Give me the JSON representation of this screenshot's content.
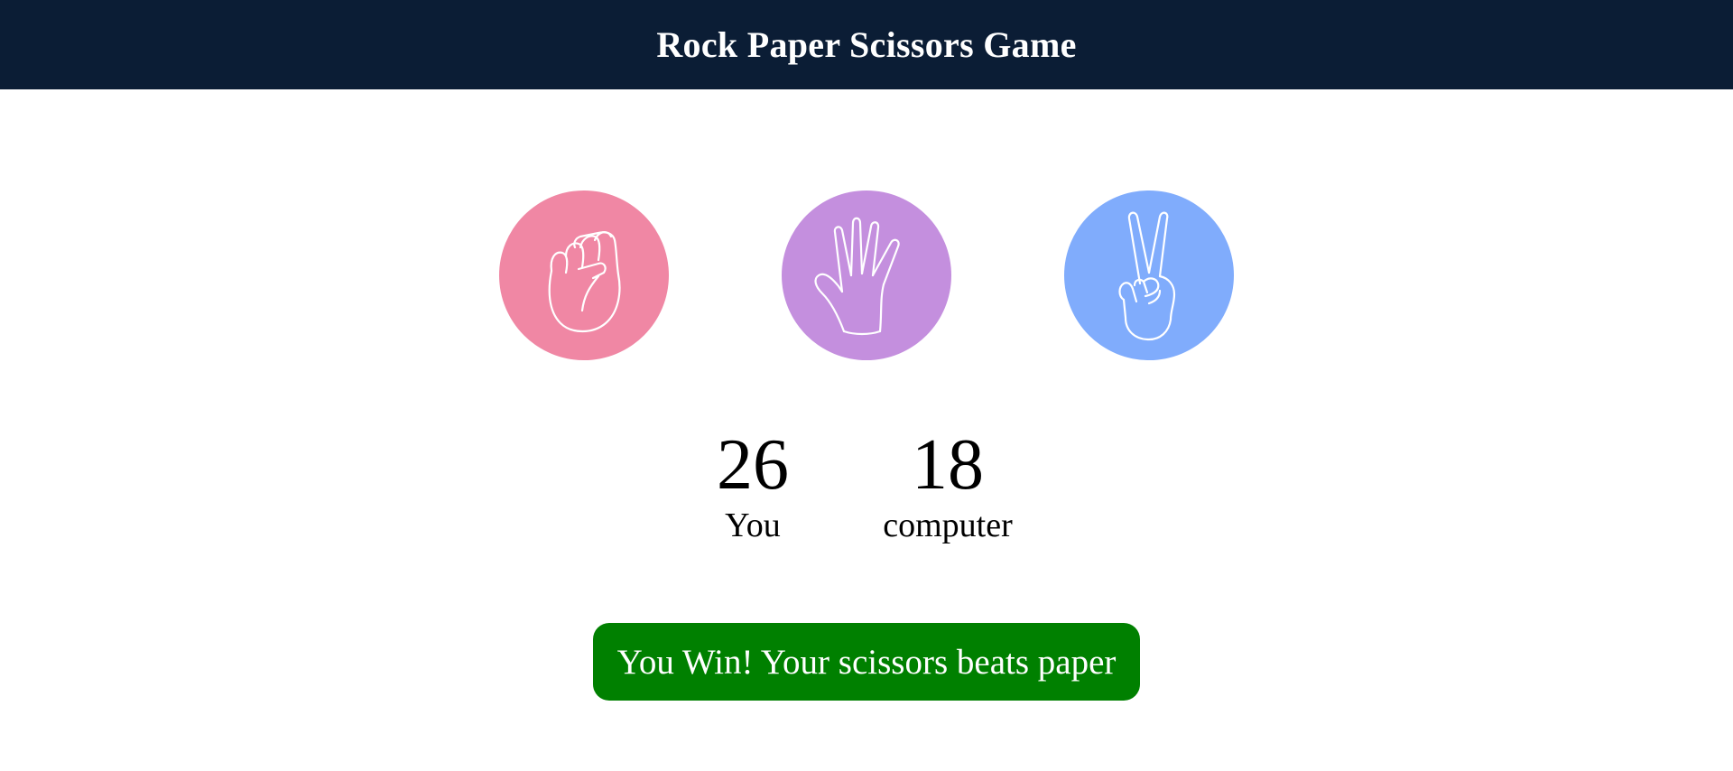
{
  "header": {
    "title": "Rock Paper Scissors Game"
  },
  "choices": [
    {
      "id": "rock",
      "icon": "rock-fist-icon",
      "color": "#f087a4"
    },
    {
      "id": "paper",
      "icon": "paper-hand-icon",
      "color": "#c48fde"
    },
    {
      "id": "scissors",
      "icon": "scissors-peace-icon",
      "color": "#80acfc"
    }
  ],
  "scoreboard": {
    "user": {
      "score": "26",
      "label": "You"
    },
    "computer": {
      "score": "18",
      "label": "computer"
    }
  },
  "message": {
    "text": "You Win! Your scissors beats paper",
    "color": "#008000"
  }
}
